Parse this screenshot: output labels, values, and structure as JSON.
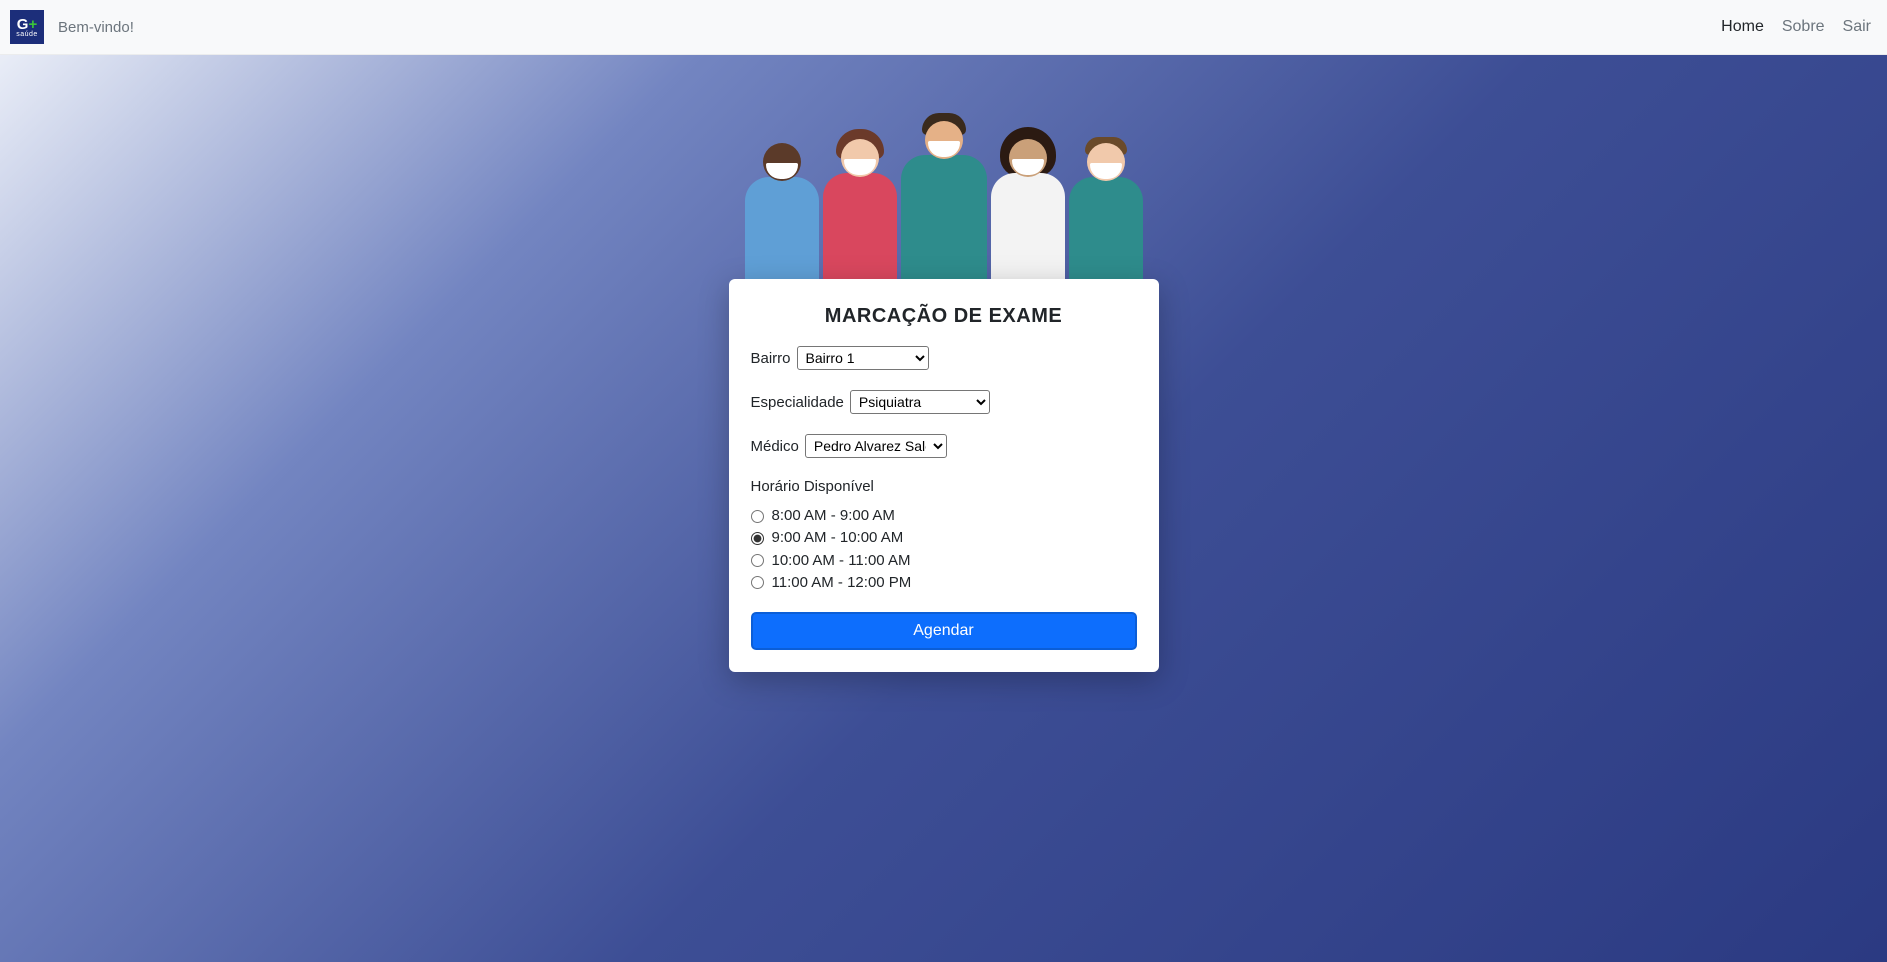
{
  "navbar": {
    "welcome": "Bem-vindo!",
    "links": {
      "home": "Home",
      "sobre": "Sobre",
      "sair": "Sair"
    },
    "logo_main": "G",
    "logo_plus": "+",
    "logo_sub": "saúde"
  },
  "card": {
    "title": "MARCAÇÃO DE EXAME",
    "labels": {
      "bairro": "Bairro",
      "especialidade": "Especialidade",
      "medico": "Médico",
      "horario": "Horário Disponível"
    },
    "selections": {
      "bairro": "Bairro 1",
      "especialidade": "Psiquiatra",
      "medico": "Pedro Alvarez Sales"
    },
    "horarios": [
      {
        "label": "8:00 AM - 9:00 AM",
        "checked": false
      },
      {
        "label": "9:00 AM - 10:00 AM",
        "checked": true
      },
      {
        "label": "10:00 AM - 11:00 AM",
        "checked": false
      },
      {
        "label": "11:00 AM - 12:00 PM",
        "checked": false
      }
    ],
    "button": "Agendar"
  }
}
